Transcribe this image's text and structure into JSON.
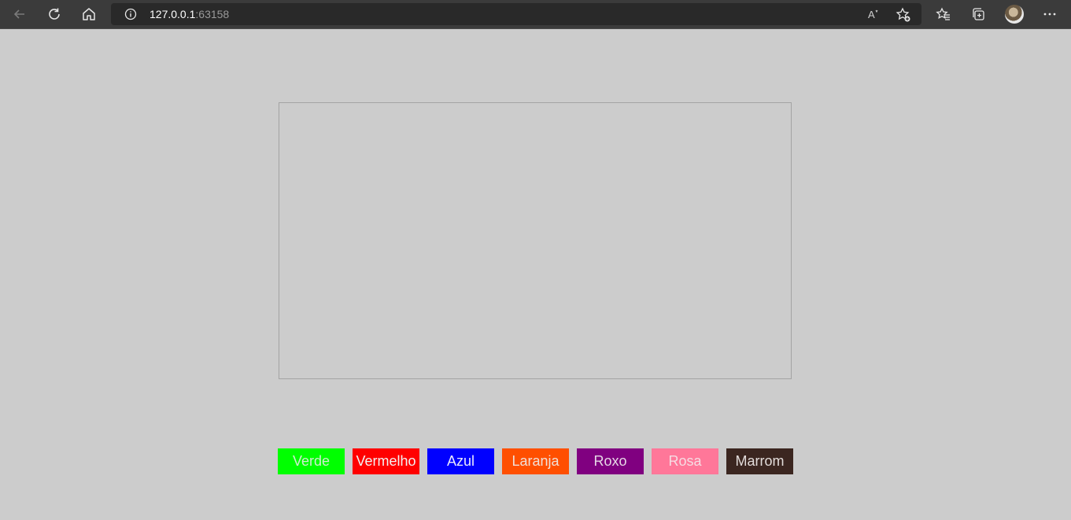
{
  "browser": {
    "address_host": "127.0.0.1",
    "address_port": ":63158",
    "icons": {
      "back": "back-arrow-icon",
      "reload": "reload-icon",
      "home": "home-icon",
      "info": "info-icon",
      "read_aloud": "read-aloud-icon",
      "add_favorite": "add-favorite-icon",
      "favorites": "favorites-icon",
      "collections": "collections-icon",
      "profile": "profile-avatar",
      "more": "more-icon"
    }
  },
  "palette": {
    "buttons": [
      {
        "label": "Verde",
        "bg": "#00ff00",
        "fg": "#cfeccf"
      },
      {
        "label": "Vermelho",
        "bg": "#ff0000",
        "fg": "#f2f2f2"
      },
      {
        "label": "Azul",
        "bg": "#0000ff",
        "fg": "#eaeaff"
      },
      {
        "label": "Laranja",
        "bg": "#ff4f00",
        "fg": "#f0e0d8"
      },
      {
        "label": "Roxo",
        "bg": "#800080",
        "fg": "#e6d8e6"
      },
      {
        "label": "Rosa",
        "bg": "#ff7799",
        "fg": "#f6dce3"
      },
      {
        "label": "Marrom",
        "bg": "#3b2620",
        "fg": "#e2dcda"
      }
    ]
  }
}
